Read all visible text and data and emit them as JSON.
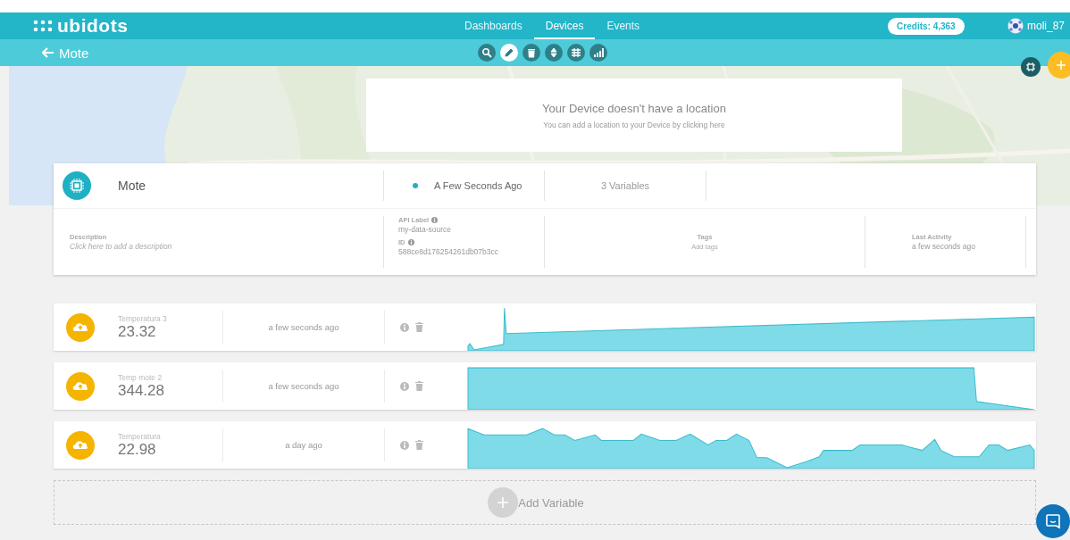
{
  "brand": {
    "name": "ubidots"
  },
  "nav": [
    {
      "label": "Dashboards",
      "selected": false
    },
    {
      "label": "Devices",
      "selected": true
    },
    {
      "label": "Events",
      "selected": false
    }
  ],
  "credits": "Credits: 4,363",
  "user": "moli_87",
  "back": {
    "label": "Mote"
  },
  "tools": [
    {
      "kind": "search",
      "selected": false
    },
    {
      "kind": "edit",
      "selected": true
    },
    {
      "kind": "delete",
      "selected": false
    },
    {
      "kind": "sort",
      "selected": false
    },
    {
      "kind": "grid",
      "selected": false
    },
    {
      "kind": "chart",
      "selected": false
    }
  ],
  "map": {
    "kind": "picture",
    "notice_title": "Your Device doesn't have a location",
    "notice_text": "You can add a location to your Device by clicking here"
  },
  "device": {
    "name": "Mote",
    "last_seen": "A Few Seconds Ago",
    "variables_count": "3 Variables",
    "description": {
      "label": "Description",
      "placeholder": "Click here to add a description"
    },
    "api_label": {
      "label": "API Label",
      "value": "my-data-source"
    },
    "id": {
      "label": "ID",
      "value": "588ce8d176254261db07b3cc"
    },
    "tags": {
      "label": "Tags",
      "placeholder": "Add tags"
    },
    "last_activity": {
      "label": "Last Activity",
      "value": "a few seconds ago"
    }
  },
  "variables": [
    {
      "name": "Temperatura 3",
      "value": "23.32",
      "time": "a few seconds ago"
    },
    {
      "name": "Temp mote 2",
      "value": "344.28",
      "time": "a few seconds ago"
    },
    {
      "name": "Temperatura",
      "value": "22.98",
      "time": "a day ago"
    }
  ],
  "add_variable": "Add Variable"
}
